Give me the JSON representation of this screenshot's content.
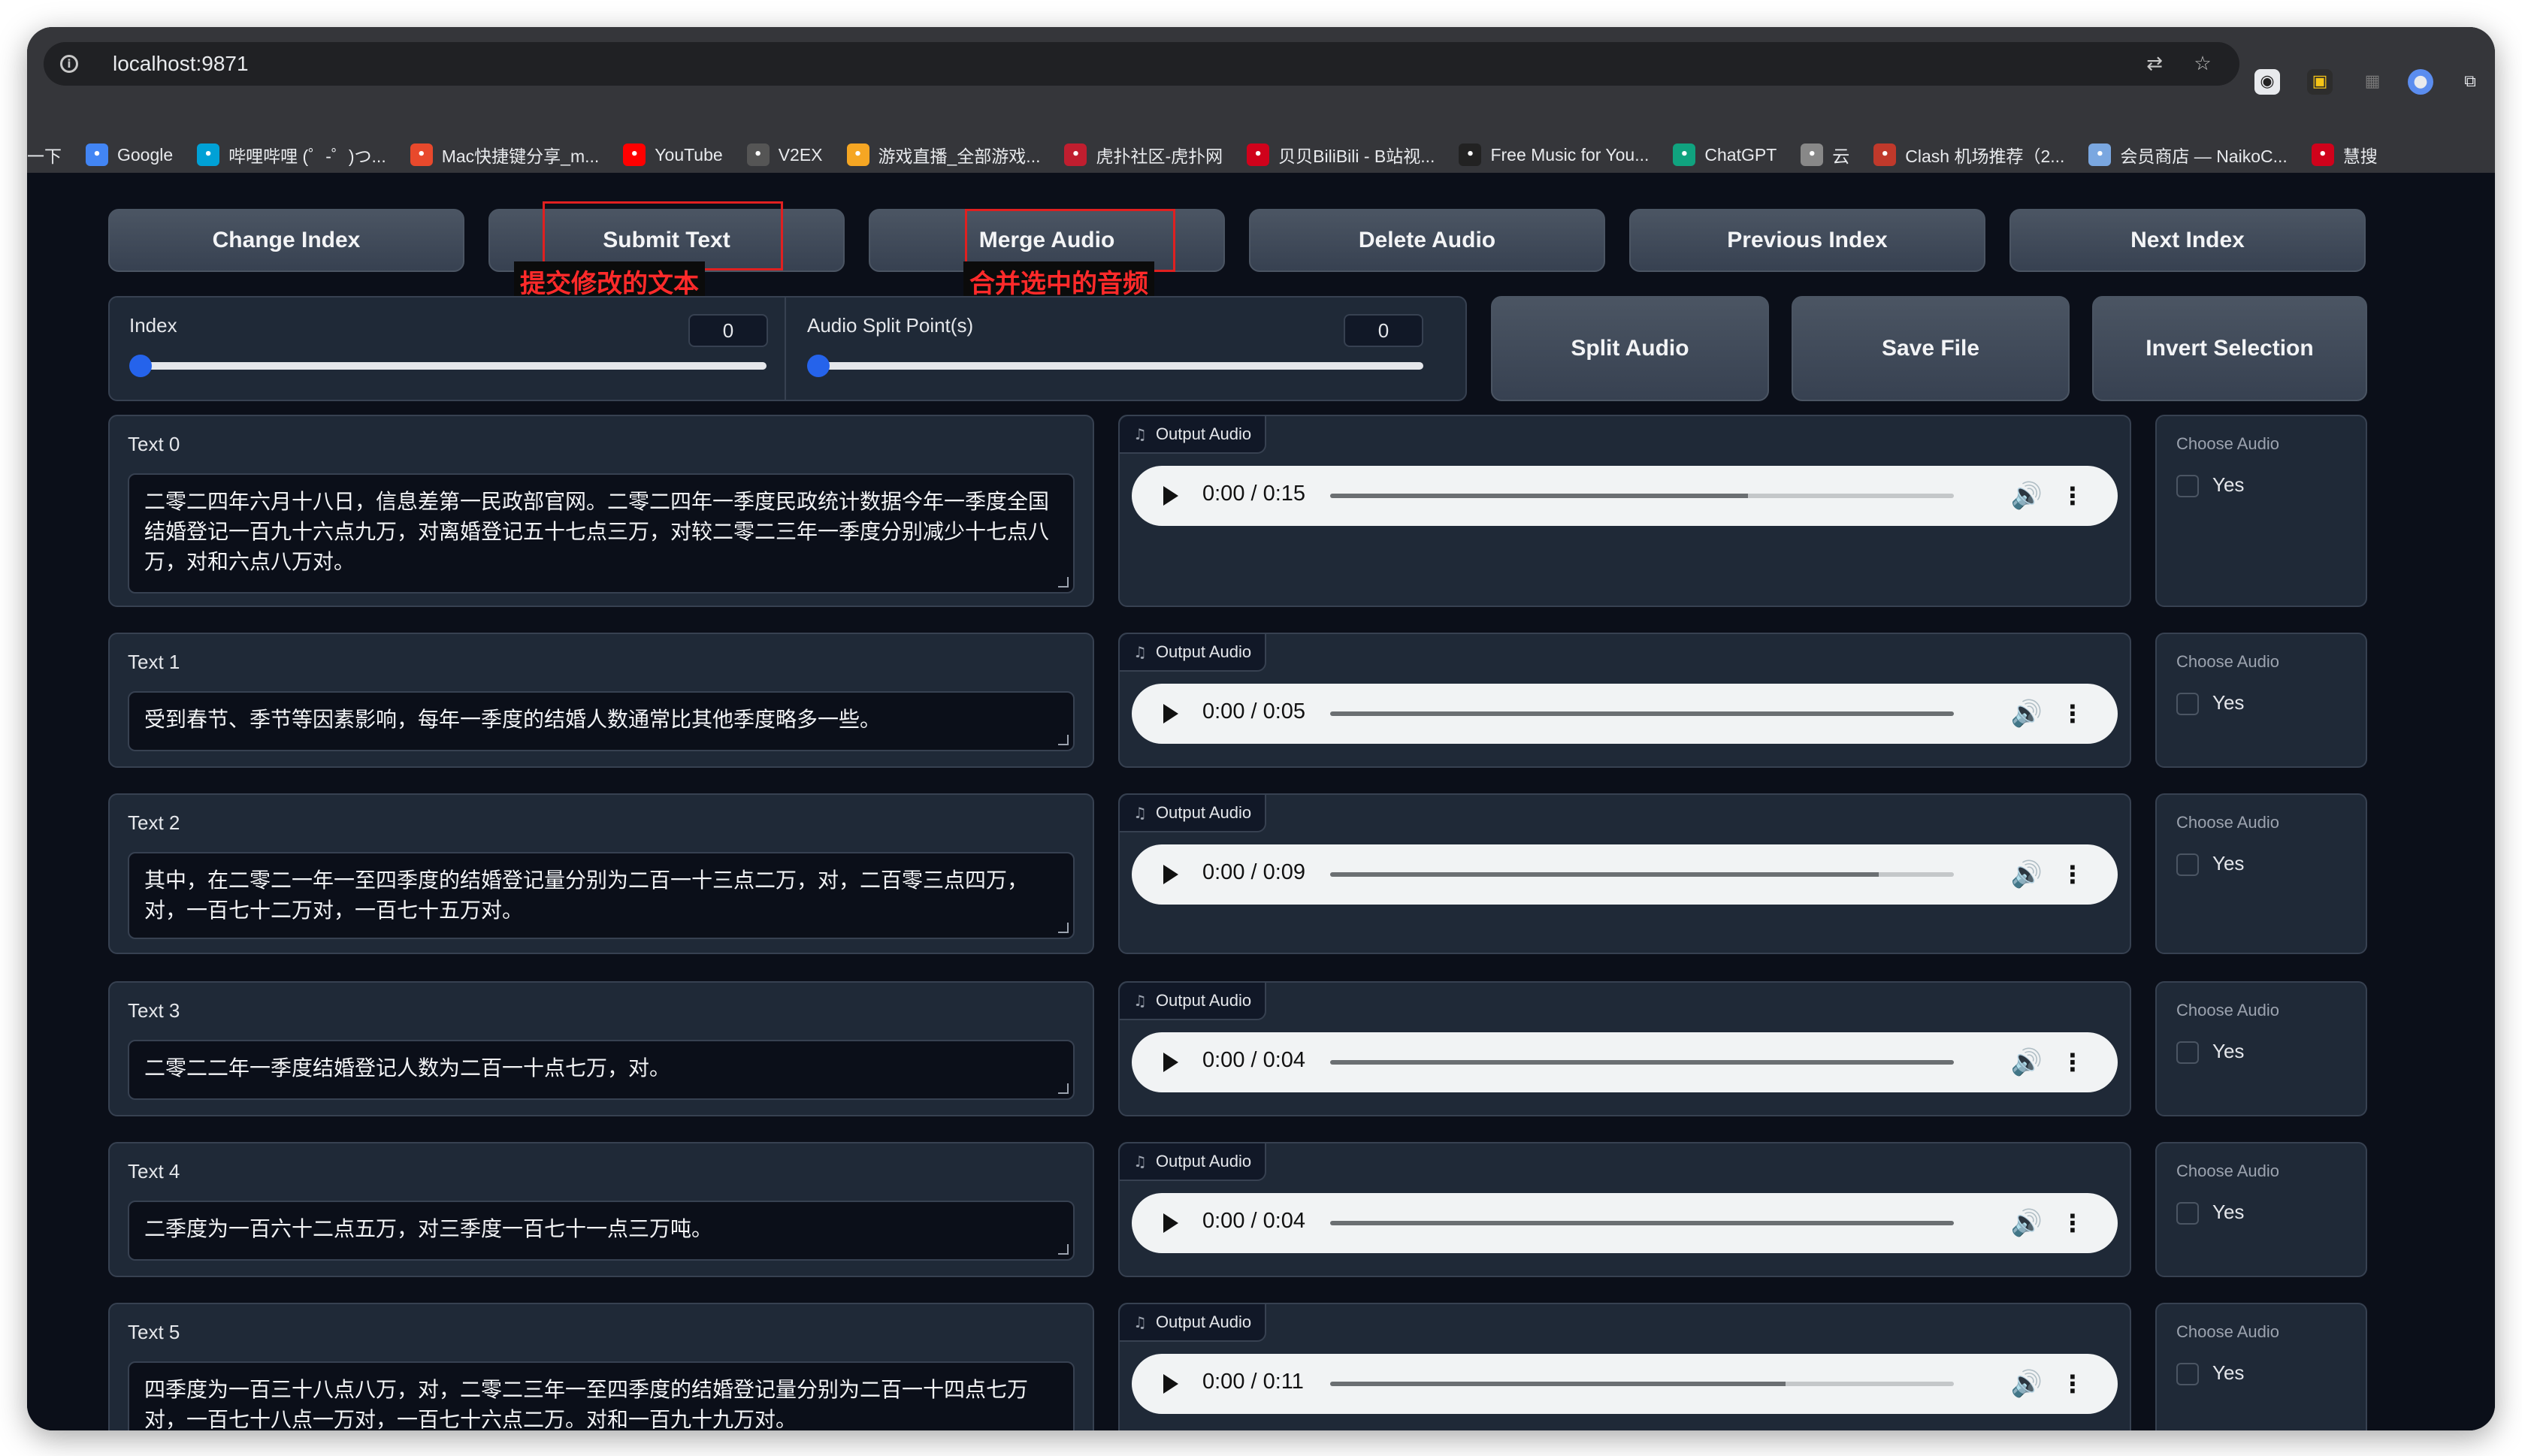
{
  "browser": {
    "url": "localhost:9871",
    "bookmarks": [
      {
        "label": "一下",
        "icon": "",
        "color": ""
      },
      {
        "label": "Google",
        "icon": "google-icon",
        "color": "#4285f4"
      },
      {
        "label": "哔哩哔哩 (゜-゜)つ...",
        "icon": "bilibili-icon",
        "color": "#00a1d6"
      },
      {
        "label": "Mac快捷键分享_m...",
        "icon": "c-logo-icon",
        "color": "#e8492c"
      },
      {
        "label": "YouTube",
        "icon": "youtube-icon",
        "color": "#ff0000"
      },
      {
        "label": "V2EX",
        "icon": "v2ex-icon",
        "color": "#555555"
      },
      {
        "label": "游戏直播_全部游戏...",
        "icon": "game-icon",
        "color": "#f5a623"
      },
      {
        "label": "虎扑社区-虎扑网",
        "icon": "hupu-icon",
        "color": "#c01e2f"
      },
      {
        "label": "贝贝BiliBili - B站视...",
        "icon": "beibei-icon",
        "color": "#d0021b"
      },
      {
        "label": "Free Music for You...",
        "icon": "music-b-icon",
        "color": "#222222"
      },
      {
        "label": "ChatGPT",
        "icon": "chatgpt-icon",
        "color": "#10a37f"
      },
      {
        "label": "云",
        "icon": "cloud-dots-icon",
        "color": "#888888"
      },
      {
        "label": "Clash 机场推荐（2...",
        "icon": "clash-icon",
        "color": "#c0392b"
      },
      {
        "label": "会员商店 — NaikoC...",
        "icon": "cloud-icon",
        "color": "#7aa7e0"
      },
      {
        "label": "慧搜",
        "icon": "huisou-icon",
        "color": "#d0021b"
      }
    ]
  },
  "toolbar": {
    "buttons": [
      "Change Index",
      "Submit Text",
      "Merge Audio",
      "Delete Audio",
      "Previous Index",
      "Next Index"
    ]
  },
  "annotations": {
    "submit_text": "提交修改的文本",
    "merge_audio": "合并选中的音频"
  },
  "controls": {
    "index_label": "Index",
    "index_value": "0",
    "split_label": "Audio Split Point(s)",
    "split_value": "0",
    "split_audio": "Split Audio",
    "save_file": "Save File",
    "invert_selection": "Invert Selection"
  },
  "audio_label": "Output Audio",
  "choose_label": "Choose Audio",
  "yes_label": "Yes",
  "rows": [
    {
      "label": "Text 0",
      "text": "二零二四年六月十八日，信息差第一民政部官网。二零二四年一季度民政统计数据今年一季度全国结婚登记一百九十六点九万，对离婚登记五十七点三万，对较二零二三年一季度分别减少十七点八万，对和六点八万对。",
      "time": "0:00 / 0:15",
      "progress": 0.67
    },
    {
      "label": "Text 1",
      "text": "受到春节、季节等因素影响，每年一季度的结婚人数通常比其他季度略多一些。",
      "time": "0:00 / 0:05",
      "progress": 1.0
    },
    {
      "label": "Text 2",
      "text": "其中，在二零二一年一至四季度的结婚登记量分别为二百一十三点二万，对，二百零三点四万，对，一百七十二万对，一百七十五万对。",
      "time": "0:00 / 0:09",
      "progress": 0.88
    },
    {
      "label": "Text 3",
      "text": "二零二二年一季度结婚登记人数为二百一十点七万，对。",
      "time": "0:00 / 0:04",
      "progress": 1.0
    },
    {
      "label": "Text 4",
      "text": "二季度为一百六十二点五万，对三季度一百七十一点三万吨。",
      "time": "0:00 / 0:04",
      "progress": 1.0
    },
    {
      "label": "Text 5",
      "text": "四季度为一百三十八点八万，对，二零二三年一至四季度的结婚登记量分别为二百一十四点七万对，一百七十八点一万对，一百七十六点二万。对和一百九十九万对。",
      "time": "0:00 / 0:11",
      "progress": 0.73
    }
  ]
}
